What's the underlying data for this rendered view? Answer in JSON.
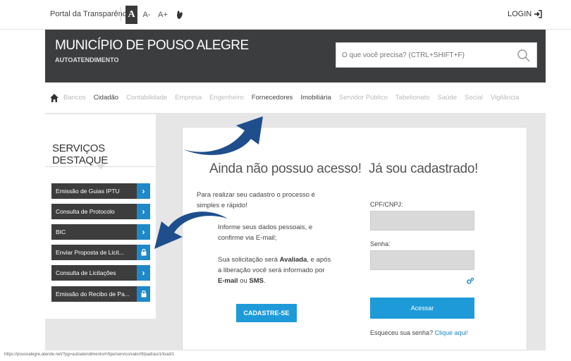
{
  "topbar": {
    "portal_label": "Portal da Transparência",
    "font_normal": "A",
    "font_smaller": "A-",
    "font_larger": "A+",
    "login_label": "LOGIN"
  },
  "header": {
    "title": "MUNICÍPIO DE POUSO ALEGRE",
    "subtitle": "AUTOATENDIMENTO",
    "search_placeholder": "O que você precisa? (CTRL+SHIFT+F)"
  },
  "nav": {
    "items": [
      {
        "label": "Bancos",
        "strong": false
      },
      {
        "label": "Cidadão",
        "strong": true
      },
      {
        "label": "Contabilidade",
        "strong": false
      },
      {
        "label": "Empresa",
        "strong": false
      },
      {
        "label": "Engenheiro",
        "strong": false
      },
      {
        "label": "Fornecedores",
        "strong": true
      },
      {
        "label": "Imobiliária",
        "strong": true
      },
      {
        "label": "Servidor Público",
        "strong": false
      },
      {
        "label": "Tabelionato",
        "strong": false
      },
      {
        "label": "Saúde",
        "strong": false
      },
      {
        "label": "Social",
        "strong": false
      },
      {
        "label": "Vigilância",
        "strong": false
      }
    ]
  },
  "services": {
    "heading": "SERVIÇOS DESTAQUE",
    "items": [
      {
        "label": "Emissão de Guias IPTU",
        "action": "chevron"
      },
      {
        "label": "Consulta de Protocolo",
        "action": "chevron"
      },
      {
        "label": "BIC",
        "action": "chevron"
      },
      {
        "label": "Enviar Proposta de Licit...",
        "action": "lock"
      },
      {
        "label": "Consulta de Licitações",
        "action": "chevron"
      },
      {
        "label": "Emissão do Recibo de Pa...",
        "action": "lock"
      }
    ]
  },
  "register": {
    "heading": "Ainda não possuo acesso!",
    "intro_line1": "Para realizar seu cadastro o processo é",
    "intro_line2": "simples e rápido!",
    "step1_line1": "Informe seus dados pessoais, e",
    "step1_line2": "confirme via E-mail;",
    "step2_line1_pre": "Sua solicitação será ",
    "step2_bold": "Avaliada",
    "step2_line1_post": ", e após",
    "step2_line2": "a liberação você será informado por",
    "step2_email": "E-mail",
    "step2_or": " ou ",
    "step2_sms": "SMS",
    "step2_end": ".",
    "button": "CADASTRE-SE"
  },
  "login": {
    "heading": "Já sou cadastrado!",
    "cpf_label": "CPF/CNPJ:",
    "cpf_value": "",
    "pwd_label": "Senha:",
    "pwd_value": "",
    "button": "Acessar",
    "forgot_text": "Esqueceu sua senha? ",
    "forgot_link": "Clique aqui!"
  },
  "status_url": "https://pousoalegre.atende.net/?pg=autoatendimento#!/tipo/servico/valor/9/padrao/1/load/1",
  "colors": {
    "header_bg": "#3b3d3f",
    "accent_blue": "#1e9ad8",
    "arrow_blue": "#1f4e8c",
    "service_bg": "#3d3d3d"
  }
}
